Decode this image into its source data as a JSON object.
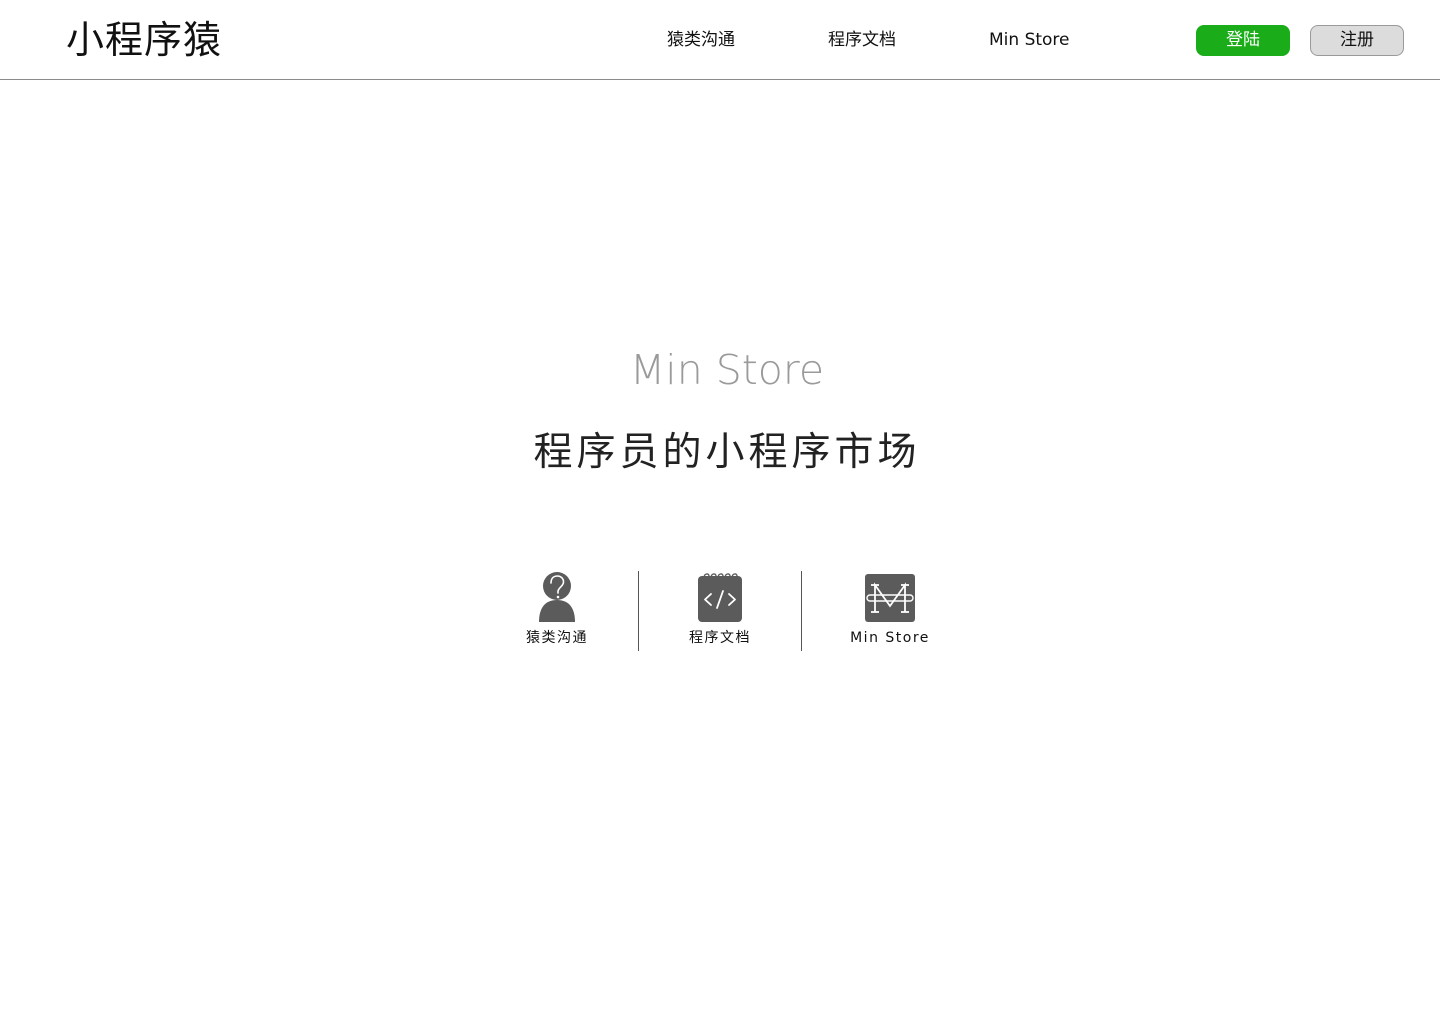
{
  "header": {
    "logo": "小程序猿",
    "nav": [
      {
        "label": "猿类沟通"
      },
      {
        "label": "程序文档"
      },
      {
        "label": "Min Store"
      }
    ],
    "login_label": "登陆",
    "register_label": "注册"
  },
  "hero": {
    "title": "Min Store",
    "subtitle": "程序员的小程序市场"
  },
  "features": [
    {
      "label": "猿类沟通",
      "icon": "question-person-icon"
    },
    {
      "label": "程序文档",
      "icon": "code-notebook-icon"
    },
    {
      "label": "Min Store",
      "icon": "min-store-icon"
    }
  ],
  "colors": {
    "accent_green": "#1aad19",
    "icon_gray": "#5b5b5b",
    "title_gray": "#9a9a9a",
    "register_bg": "#dcdcdc"
  }
}
